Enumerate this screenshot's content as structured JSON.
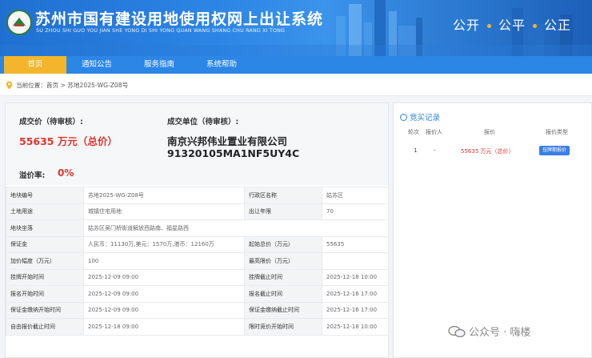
{
  "header": {
    "title": "苏州市国有建设用地使用权网上出让系统",
    "subtitle": "SU ZHOU SHI GUO YOU JIAN SHE YONG DI SHI YONG QUAN WANG SHANG CHU RANG XI TONG",
    "slogan": [
      "公开",
      "公平",
      "公正"
    ],
    "logo_icon": "land-logo-icon"
  },
  "nav": {
    "items": [
      {
        "label": "首页",
        "active": true
      },
      {
        "label": "通知公告",
        "active": false
      },
      {
        "label": "服务指南",
        "active": false
      },
      {
        "label": "系统帮助",
        "active": false
      }
    ]
  },
  "breadcrumb": {
    "prefix": "当前位置：",
    "path": "首页 > 苏地2025-WG-Z08号",
    "icon": "location-pin-icon"
  },
  "summary": {
    "price_label": "成交价（待审核）:",
    "price_value": "55635 万元（总价）",
    "premium_label": "溢价率:",
    "premium_value": "0%",
    "winner_label": "成交单位（待审核）:",
    "winner_name": "南京兴邦伟业置业有限公司",
    "winner_code": "91320105MA1NF5UY4C"
  },
  "details": {
    "rows": [
      [
        "地块编号",
        "苏地2025-WG-Z08号",
        "行政区名称",
        "姑苏区"
      ],
      [
        "土地用途",
        "城镇住宅用地",
        "出让年限",
        "70"
      ],
      [
        "地块坐落",
        "姑苏区吴门桥街道解放西路南、福星路西",
        "",
        ""
      ],
      [
        "保证金",
        "人民币：11130万,美元：1570万,港币：12160万",
        "起始总价（万元）",
        "55635"
      ],
      [
        "加价幅度（万元）",
        "100",
        "最高限价（万元）",
        ""
      ],
      [
        "挂牌开始时间",
        "2025-12-09 09:00",
        "挂牌截止时间",
        "2025-12-18 10:00"
      ],
      [
        "报名开始时间",
        "2025-12-09 09:00",
        "报名截止时间",
        "2025-12-16 17:00"
      ],
      [
        "保证金缴纳开始时间",
        "2025-12-09 09:00",
        "保证金缴纳截止时间",
        "2025-12-16 17:00"
      ],
      [
        "自由报价截止时间",
        "2025-12-18 09:00",
        "限时竞价开始时间",
        "2025-12-18 10:00"
      ]
    ]
  },
  "bids": {
    "title": "竞买记录",
    "icon": "record-icon",
    "headers": [
      "轮次",
      "报价人",
      "报价",
      "报价类型"
    ],
    "rows": [
      {
        "round": "1",
        "bidder": "-",
        "price": "55635 万元（总价）",
        "type": "挂牌期报价"
      }
    ],
    "accent": "#2b86e6",
    "price_color": "#e0342c"
  },
  "watermark": {
    "text": "公众号 · 嗨楼",
    "icon": "wechat-icon"
  }
}
